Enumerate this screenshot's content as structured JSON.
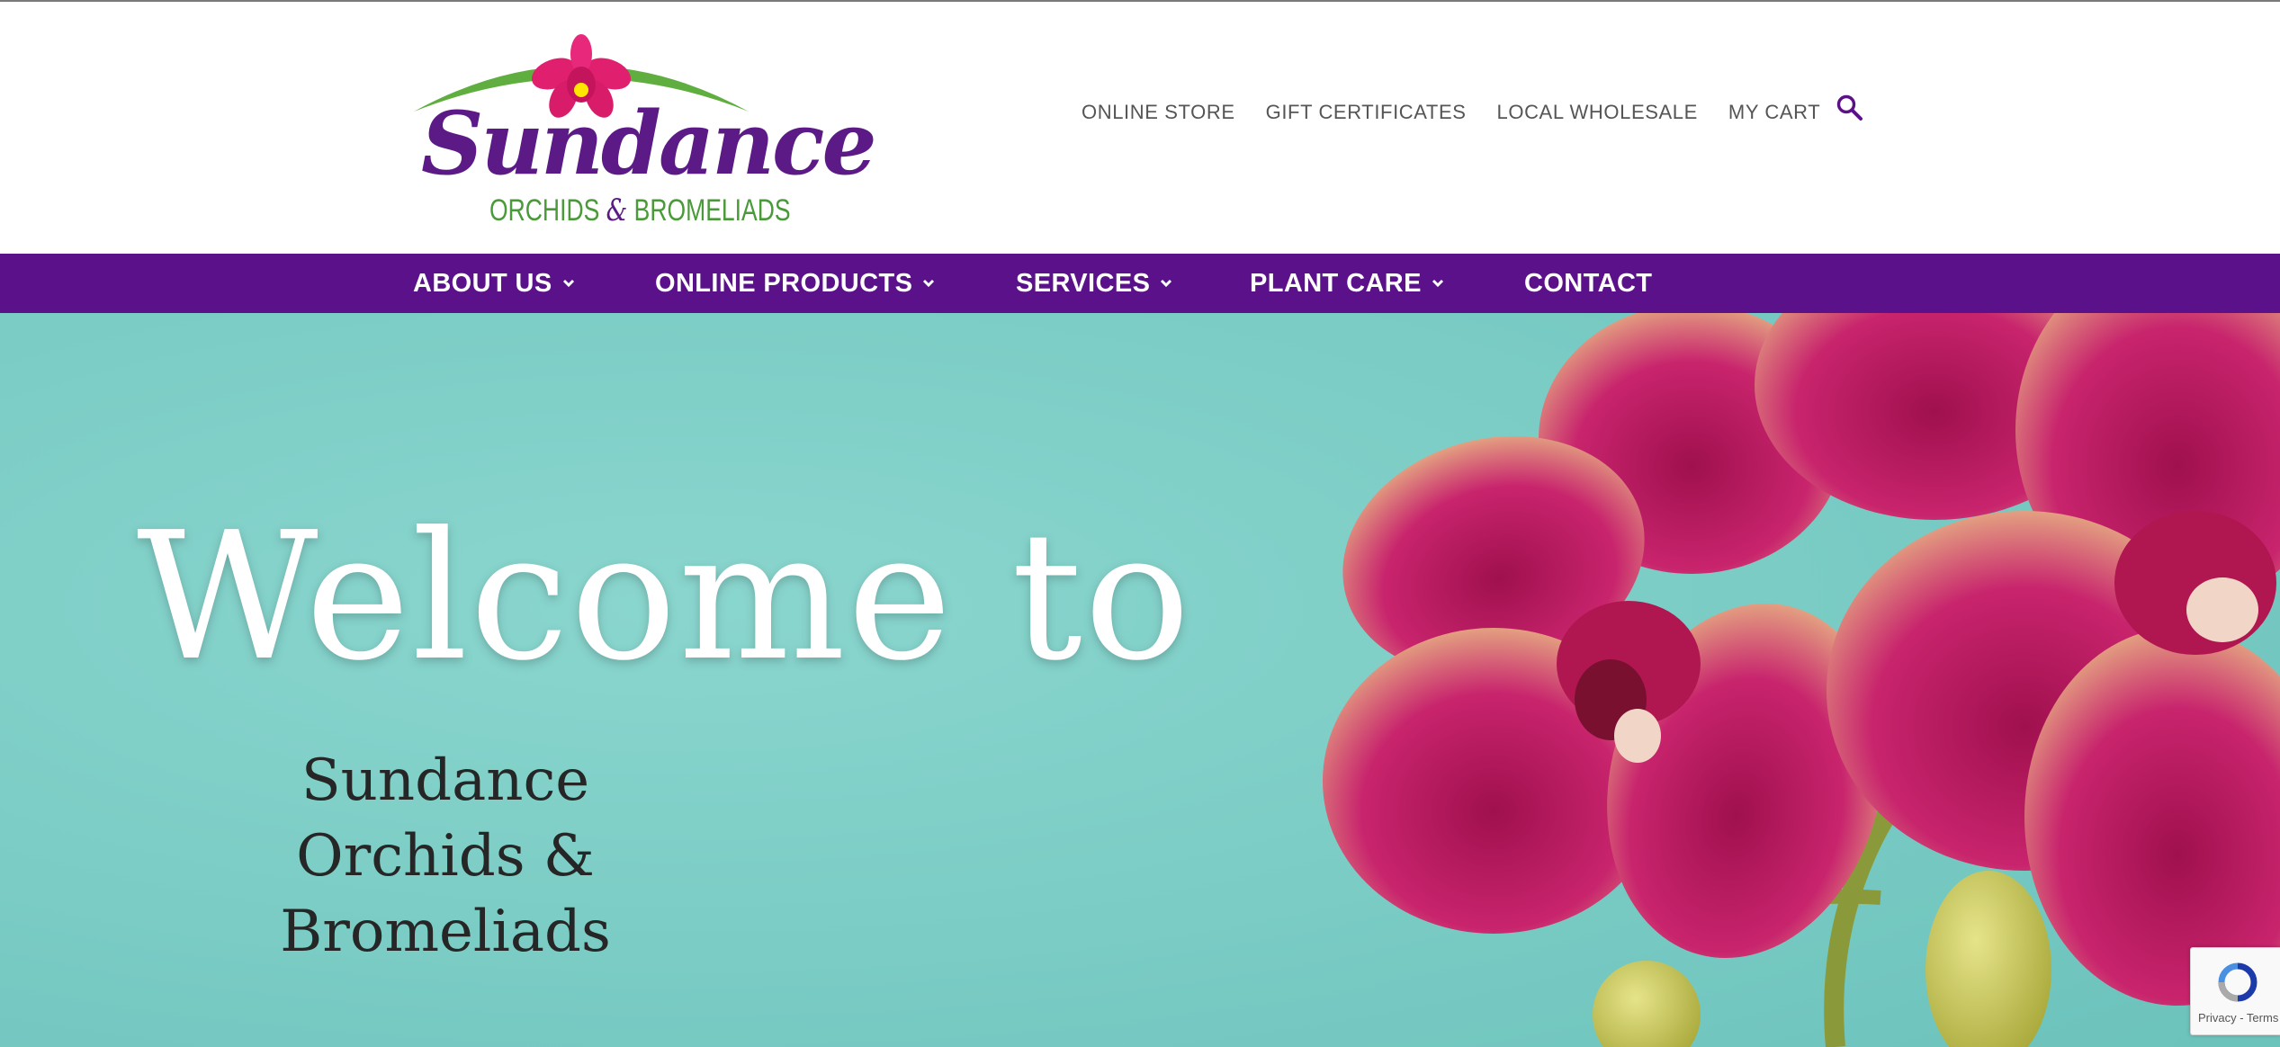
{
  "brand": {
    "name": "Sundance",
    "tagline_left": "ORCHIDS",
    "tagline_amp": "&",
    "tagline_right": "BROMELIADS"
  },
  "utility_nav": [
    {
      "label": "ONLINE STORE"
    },
    {
      "label": "GIFT CERTIFICATES"
    },
    {
      "label": "LOCAL WHOLESALE"
    },
    {
      "label": "MY CART"
    }
  ],
  "main_nav": [
    {
      "label": "ABOUT US",
      "has_dropdown": true
    },
    {
      "label": "ONLINE PRODUCTS",
      "has_dropdown": true
    },
    {
      "label": "SERVICES",
      "has_dropdown": true
    },
    {
      "label": "PLANT CARE",
      "has_dropdown": true
    },
    {
      "label": "CONTACT",
      "has_dropdown": false
    }
  ],
  "hero": {
    "headline": "Welcome to",
    "subtitle_line1": "Sundance",
    "subtitle_line2": "Orchids & Bromeliads"
  },
  "recaptcha": {
    "links": "Privacy - Terms"
  },
  "colors": {
    "nav_purple": "#5b1189",
    "brand_purple": "#5b1a86",
    "brand_green": "#4a9a3a",
    "hero_teal": "#7fcdc6",
    "orchid_magenta": "#c2185b"
  },
  "icons": [
    "search-icon",
    "chevron-down-icon",
    "recaptcha-icon"
  ]
}
